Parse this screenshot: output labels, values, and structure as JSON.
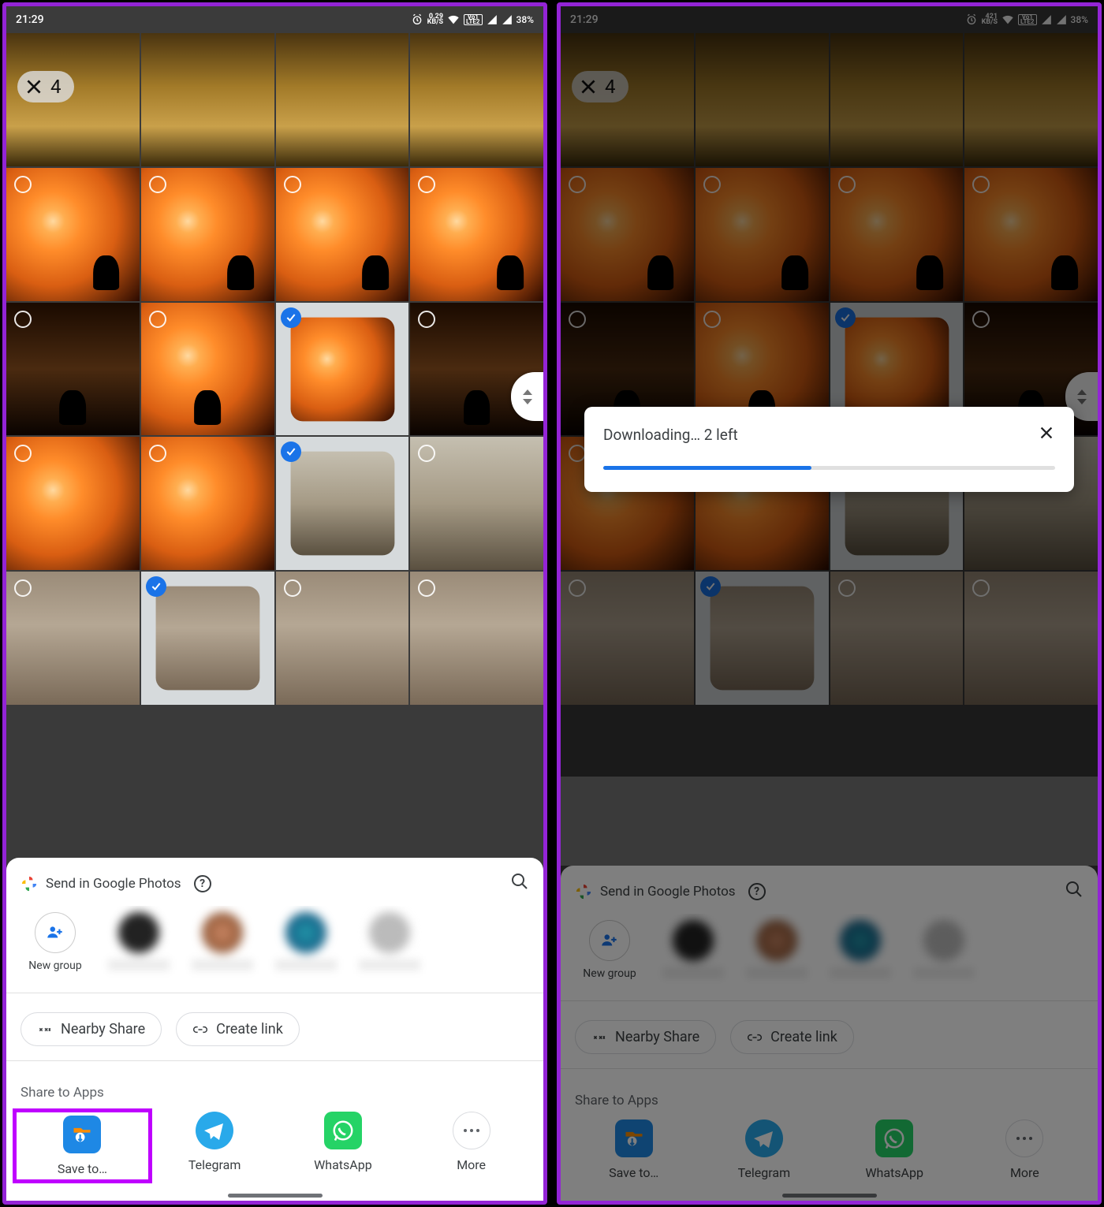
{
  "statusbar": {
    "time": "21:29",
    "net_rate_left": "0.29",
    "net_rate_right": "421",
    "net_rate_unit": "KB/S",
    "battery": "38%"
  },
  "selection": {
    "count": "4"
  },
  "sheet": {
    "header": "Send in Google Photos",
    "contacts": {
      "new_group": "New group"
    },
    "nearby": "Nearby Share",
    "create_link": "Create link",
    "share_to_apps": "Share to Apps",
    "apps": {
      "save_to": "Save to…",
      "telegram": "Telegram",
      "whatsapp": "WhatsApp",
      "more": "More"
    }
  },
  "dialog": {
    "text": "Downloading… 2 left"
  },
  "grid": {
    "rows": [
      [
        {
          "cls": "sunset1",
          "sel": false,
          "ring": false
        },
        {
          "cls": "sunset1",
          "sel": false,
          "ring": false
        },
        {
          "cls": "sunset1",
          "sel": false,
          "ring": false
        },
        {
          "cls": "sunset1",
          "sel": false,
          "ring": false
        }
      ],
      [
        {
          "cls": "sunset-orange silfig right",
          "sel": false,
          "ring": true
        },
        {
          "cls": "sunset-orange silfig right",
          "sel": false,
          "ring": true
        },
        {
          "cls": "sunset-orange silfig right",
          "sel": false,
          "ring": true
        },
        {
          "cls": "sunset-orange silfig right",
          "sel": false,
          "ring": true
        }
      ],
      [
        {
          "cls": "dark-silhouette silfig",
          "sel": false,
          "ring": true
        },
        {
          "cls": "sunset-orange silfig",
          "sel": false,
          "ring": true
        },
        {
          "cls": "sunset-orange",
          "sel": true,
          "ring": false
        },
        {
          "cls": "dark-silhouette silfig",
          "sel": false,
          "ring": true
        }
      ],
      [
        {
          "cls": "sunset-orange",
          "sel": false,
          "ring": true
        },
        {
          "cls": "sunset-orange",
          "sel": false,
          "ring": true
        },
        {
          "cls": "pier",
          "sel": true,
          "ring": false
        },
        {
          "cls": "pier",
          "sel": false,
          "ring": true
        }
      ],
      [
        {
          "cls": "foggy",
          "sel": false,
          "ring": true
        },
        {
          "cls": "foggy",
          "sel": true,
          "ring": false
        },
        {
          "cls": "foggy",
          "sel": false,
          "ring": true
        },
        {
          "cls": "foggy",
          "sel": false,
          "ring": true
        }
      ]
    ]
  }
}
